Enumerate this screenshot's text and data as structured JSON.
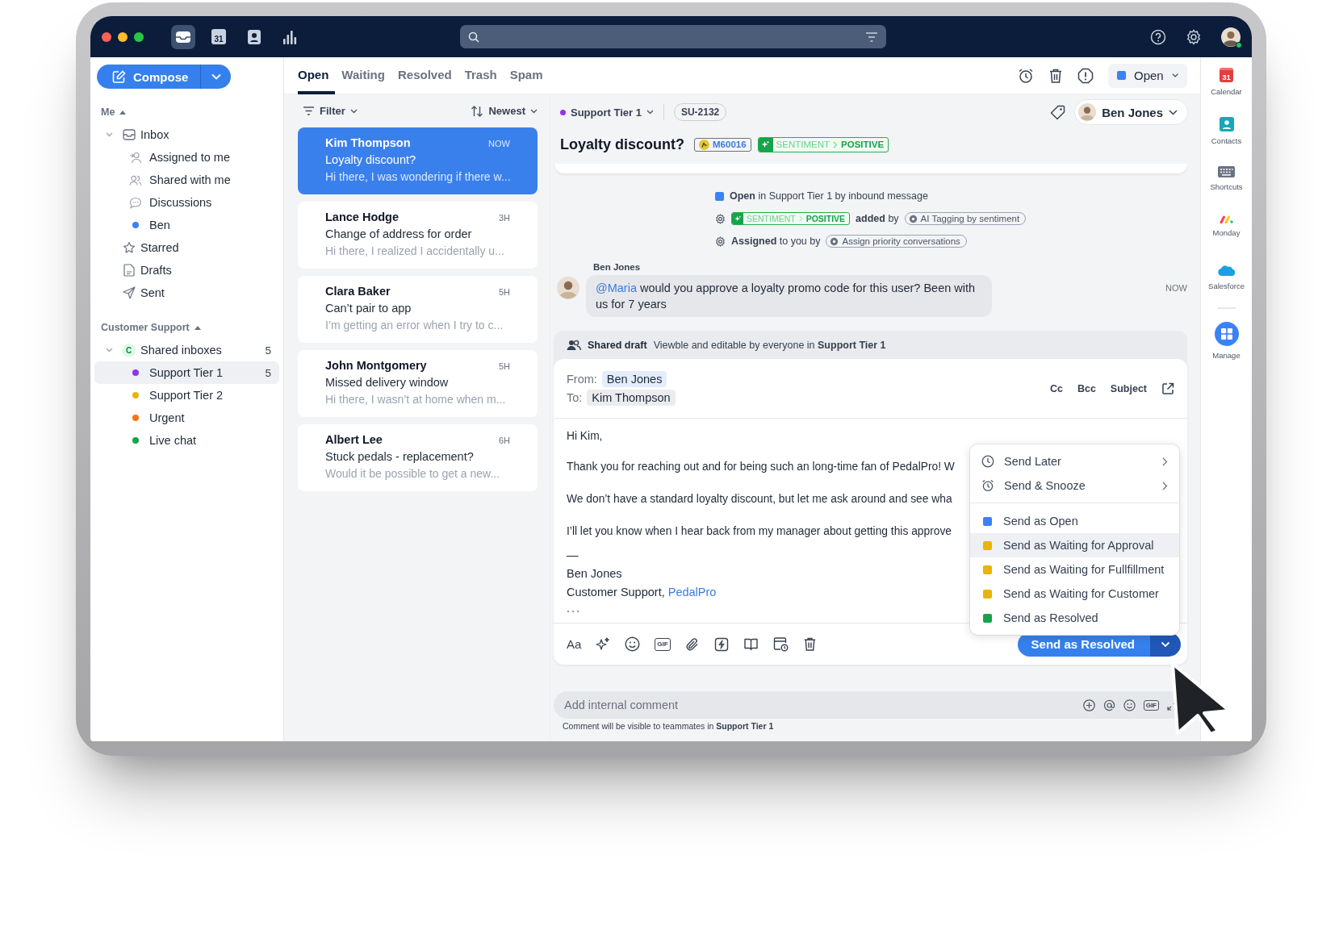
{
  "top_bar": {
    "apps": [
      {
        "kind": "inbox",
        "selected": true
      },
      {
        "kind": "calendar",
        "selected": false,
        "day": "31"
      },
      {
        "kind": "contacts",
        "selected": false
      },
      {
        "kind": "analytics",
        "selected": false
      }
    ],
    "user": {
      "online": true
    }
  },
  "compose": {
    "label": "Compose"
  },
  "sidebar": {
    "sections": [
      {
        "title": "Me",
        "expanded": true,
        "items": [
          {
            "kind": "inbox",
            "label": "Inbox",
            "expanded": true,
            "selected": false,
            "children": [
              {
                "kind": "assigned",
                "label": "Assigned to me",
                "selected": false
              },
              {
                "kind": "shared",
                "label": "Shared with me",
                "selected": false
              },
              {
                "kind": "discussions",
                "label": "Discussions",
                "selected": false
              },
              {
                "kind": "tag",
                "label": "Ben",
                "color": "#3b82f6",
                "selected": false
              }
            ]
          },
          {
            "kind": "starred",
            "label": "Starred",
            "selected": false
          },
          {
            "kind": "drafts",
            "label": "Drafts",
            "selected": false
          },
          {
            "kind": "sent",
            "label": "Sent",
            "selected": false
          }
        ]
      },
      {
        "title": "Customer Support",
        "expanded": true,
        "items": [
          {
            "kind": "team",
            "label": "Shared inboxes",
            "badge": "C",
            "count": "5",
            "expanded": true,
            "selected": false,
            "children": [
              {
                "kind": "tag",
                "label": "Support Tier 1",
                "count": "5",
                "color": "#9333ea",
                "selected": true
              },
              {
                "kind": "tag",
                "label": "Support Tier 2",
                "color": "#eab308",
                "selected": false
              },
              {
                "kind": "tag",
                "label": "Urgent",
                "color": "#f97316",
                "selected": false
              },
              {
                "kind": "tag",
                "label": "Live chat",
                "color": "#16a34a",
                "selected": false
              }
            ]
          }
        ]
      }
    ]
  },
  "tabs": [
    {
      "label": "Open",
      "selected": true
    },
    {
      "label": "Waiting",
      "selected": false
    },
    {
      "label": "Resolved",
      "selected": false
    },
    {
      "label": "Trash",
      "selected": false
    },
    {
      "label": "Spam",
      "selected": false
    }
  ],
  "status_menu": {
    "label": "Open",
    "color": "#3b82f6"
  },
  "list_toolbar": {
    "filter": "Filter",
    "sort": "Newest"
  },
  "conversations": [
    {
      "name": "Kim Thompson",
      "time": "NOW",
      "subject": "Loyalty discount?",
      "preview": "Hi there, I was wondering if there w...",
      "selected": true
    },
    {
      "name": "Lance Hodge",
      "time": "3H",
      "subject": "Change of address for order",
      "preview": "Hi there, I realized I accidentally u...",
      "selected": false
    },
    {
      "name": "Clara Baker",
      "time": "5H",
      "subject": "Can’t pair to app",
      "preview": "I’m getting an error when I try to c...",
      "selected": false
    },
    {
      "name": "John Montgomery",
      "time": "5H",
      "subject": "Missed delivery window",
      "preview": "Hi there, I wasn’t at home when m...",
      "selected": false
    },
    {
      "name": "Albert Lee",
      "time": "6H",
      "subject": "Stuck pedals - replacement?",
      "preview": "Would it be possible to get a new...",
      "selected": false
    }
  ],
  "conversation": {
    "inbox": "Support Tier 1",
    "id": "SU-2132",
    "assignee": "Ben Jones",
    "title": "Loyalty discount?",
    "tags": [
      {
        "kind": "order",
        "label": "M60016"
      },
      {
        "kind": "sentiment",
        "category": "SENTIMENT",
        "value": "POSITIVE"
      }
    ],
    "activity": [
      {
        "kind": "status",
        "color": "#3b82f6",
        "text": "**Open** in Support Tier 1 by inbound message"
      },
      {
        "kind": "tag",
        "tag": {
          "category": "SENTIMENT",
          "value": "POSITIVE"
        },
        "text": "**added** by",
        "rule": "AI Tagging by sentiment"
      },
      {
        "kind": "rule",
        "text": "**Assigned** to you by",
        "rule": "Assign priority conversations"
      }
    ],
    "comment": {
      "author": "Ben Jones",
      "mention": "@Maria",
      "text": "would you approve a loyalty promo code for this user? Been with us for 7 years",
      "time": "NOW"
    }
  },
  "draft": {
    "title": "Shared draft",
    "note": "Viewble and editable by everyone in **Support Tier 1**",
    "from_label": "From:",
    "from": "Ben Jones",
    "to_label": "To:",
    "to": "Kim Thompson",
    "header_links": [
      "Cc",
      "Bcc",
      "Subject"
    ],
    "body": [
      "Hi Kim,",
      "Thank you for reaching out and for being such an long-time fan of PedalPro! W",
      "We don’t have a standard loyalty discount, but let me ask around and see wha",
      "I’ll let you know when I hear back from my manager about getting this approve"
    ],
    "signature": {
      "dash": "—",
      "name": "Ben Jones",
      "line": "Customer Support, ",
      "link": "PedalPro"
    },
    "format_label": "Aa",
    "gif_label": "GIF",
    "send": "Send as Resolved",
    "menu": [
      {
        "kind": "action",
        "label": "Send Later",
        "submenu": true,
        "selected": false
      },
      {
        "kind": "action",
        "label": "Send & Snooze",
        "submenu": true,
        "selected": false
      },
      {
        "kind": "status",
        "label": "Send as Open",
        "color": "#3b82f6",
        "selected": false
      },
      {
        "kind": "status",
        "label": "Send as Waiting for Approval",
        "color": "#eab308",
        "selected": true
      },
      {
        "kind": "status",
        "label": "Send as Waiting for Fullfillment",
        "color": "#eab308",
        "selected": false
      },
      {
        "kind": "status",
        "label": "Send as Waiting for Customer",
        "color": "#eab308",
        "selected": false
      },
      {
        "kind": "status",
        "label": "Send as Resolved",
        "color": "#16a34a",
        "selected": false
      }
    ]
  },
  "comment_box": {
    "placeholder": "Add internal comment",
    "gif_label": "GIF",
    "note": "Comment will be visible to teammates in **Support Tier 1**"
  },
  "right_rail": [
    {
      "kind": "calendar",
      "label": "Calendar",
      "day": "31"
    },
    {
      "kind": "contacts",
      "label": "Contacts"
    },
    {
      "kind": "keyboard",
      "label": "Shortcuts"
    },
    {
      "kind": "stripes",
      "label": "Monday"
    },
    {
      "kind": "cloud",
      "label": "Salesforce"
    },
    {
      "kind": "grid",
      "label": "Manage"
    }
  ]
}
